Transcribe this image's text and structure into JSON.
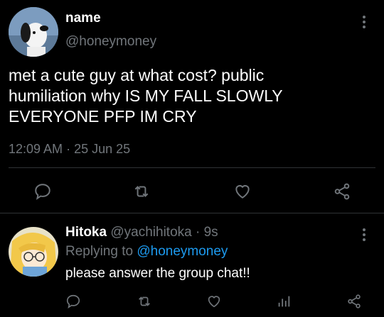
{
  "tweet": {
    "display_name": "name",
    "handle": "@honeymoney",
    "text": "met a cute guy at what cost? public humiliation why IS MY FALL SLOWLY EVERYONE PFP IM CRY",
    "time": "12:09 AM",
    "separator": "·",
    "date": "25 Jun 25",
    "actions": [
      "reply-icon",
      "retweet-icon",
      "like-icon",
      "share-icon"
    ]
  },
  "reply": {
    "display_name": "Hitoka",
    "handle": "@yachihitoka",
    "separator": "·",
    "age": "9s",
    "replying_prefix": "Replying to",
    "replying_to": "@honeymoney",
    "text": "please answer the group chat!!",
    "actions": [
      "reply-icon",
      "retweet-icon",
      "like-icon",
      "analytics-icon",
      "share-icon"
    ]
  },
  "colors": {
    "background": "#000000",
    "text": "#ffffff",
    "muted": "#71767b",
    "link": "#1d9bf0",
    "divider": "#2f3336"
  }
}
